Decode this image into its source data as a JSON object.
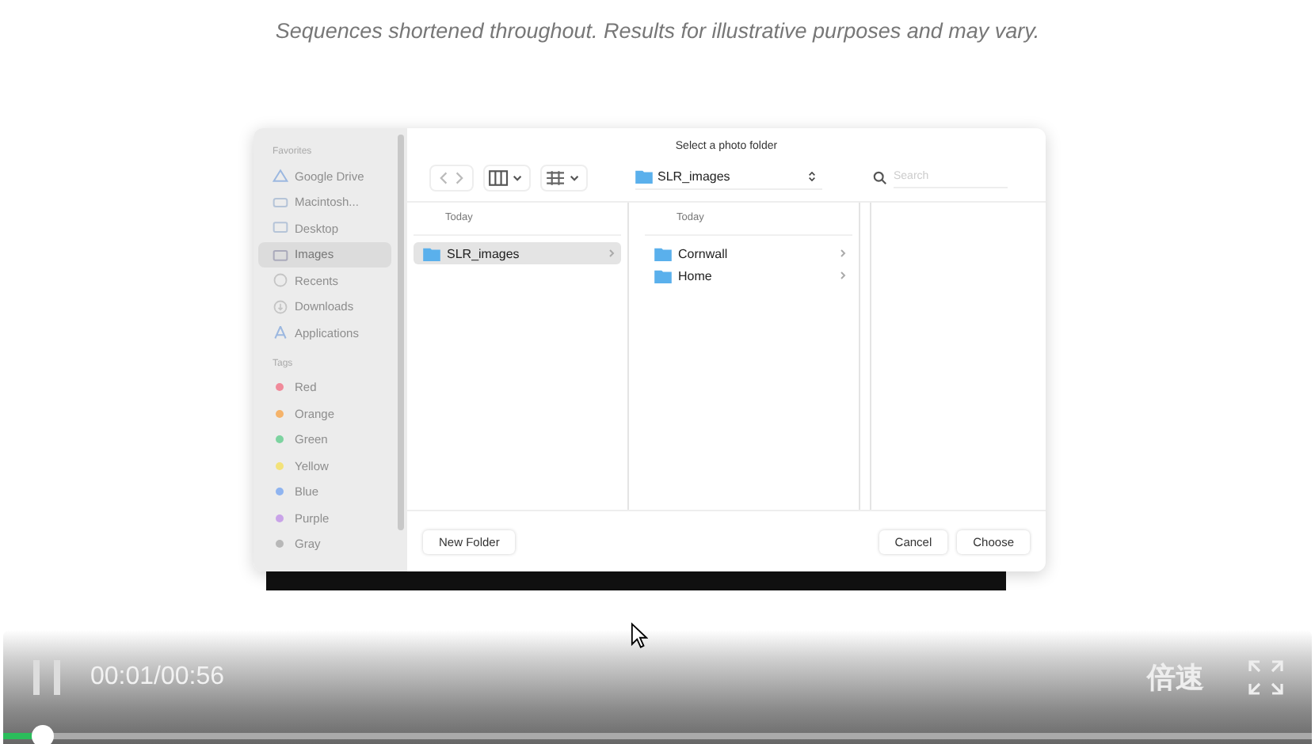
{
  "caption": "Sequences shortened throughout. Results for illustrative purposes and may vary.",
  "dialog": {
    "title": "Select a photo folder",
    "favorites": {
      "heading": "Favorites",
      "items": [
        {
          "label": "Google Drive",
          "kind": "drive",
          "selected": false
        },
        {
          "label": "Macintosh...",
          "kind": "disk",
          "selected": false
        },
        {
          "label": "Desktop",
          "kind": "desktop",
          "selected": false
        },
        {
          "label": "Images",
          "kind": "folder",
          "selected": true
        },
        {
          "label": "Recents",
          "kind": "clock",
          "selected": false
        },
        {
          "label": "Downloads",
          "kind": "download",
          "selected": false
        },
        {
          "label": "Applications",
          "kind": "apps",
          "selected": false
        }
      ]
    },
    "tags": {
      "heading": "Tags",
      "items": [
        {
          "label": "Red",
          "color": "#f08a9a"
        },
        {
          "label": "Orange",
          "color": "#f5b36a"
        },
        {
          "label": "Green",
          "color": "#7dd3a0"
        },
        {
          "label": "Yellow",
          "color": "#f3e27a"
        },
        {
          "label": "Blue",
          "color": "#8fb4f0"
        },
        {
          "label": "Purple",
          "color": "#c9a3e8"
        },
        {
          "label": "Gray",
          "color": "#b8b8b8"
        }
      ]
    },
    "location": "SLR_images",
    "search": {
      "placeholder": "Search"
    },
    "columns": [
      {
        "heading": "Today",
        "items": [
          {
            "label": "SLR_images",
            "selected": true
          }
        ]
      },
      {
        "heading": "Today",
        "items": [
          {
            "label": "Cornwall",
            "selected": false
          },
          {
            "label": "Home",
            "selected": false
          }
        ]
      }
    ],
    "buttons": [
      {
        "label": "New Folder",
        "kind": "left"
      },
      {
        "label": "Cancel",
        "kind": "right"
      },
      {
        "label": "Choose",
        "kind": "right"
      }
    ]
  },
  "player": {
    "playing": true,
    "time": "00:01/00:56",
    "speed": "倍速",
    "progress": {
      "level": 0.03
    }
  }
}
